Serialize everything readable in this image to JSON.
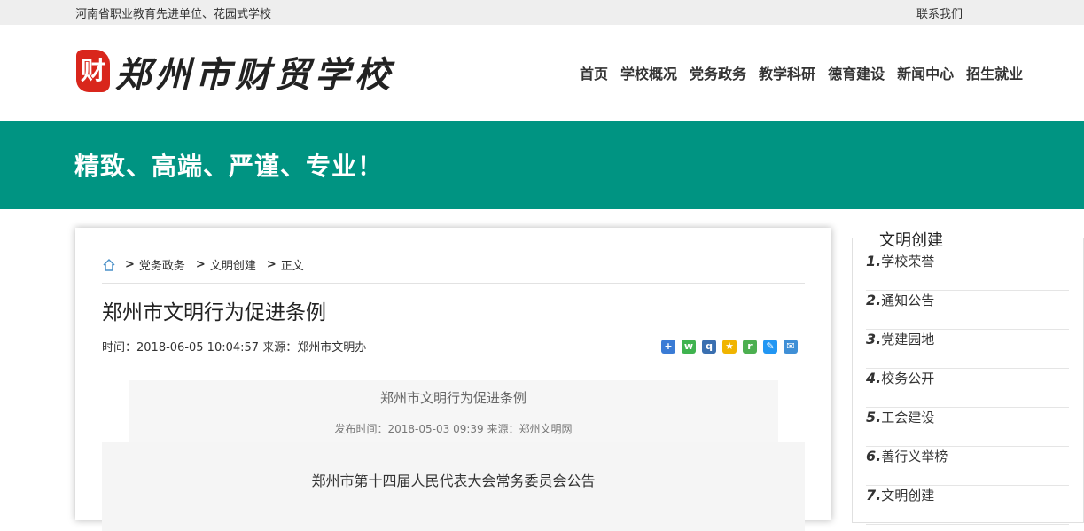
{
  "topbar": {
    "left_text": "河南省职业教育先进单位、花园式学校",
    "contact": "联系我们"
  },
  "logo": {
    "seal_char": "财",
    "name": "郑州市财贸学校"
  },
  "nav": {
    "items": [
      "首页",
      "学校概况",
      "党务政务",
      "教学科研",
      "德育建设",
      "新闻中心",
      "招生就业"
    ]
  },
  "banner": {
    "slogan": "精致、高端、严谨、专业！"
  },
  "breadcrumb": {
    "sep": ">",
    "items": [
      "党务政务",
      "文明创建",
      "正文"
    ]
  },
  "article": {
    "title": "郑州市文明行为促进条例",
    "meta": "时间：2018-06-05 10:04:57 来源：郑州市文明办",
    "inner_title": "郑州市文明行为促进条例",
    "inner_meta": "发布时间：2018-05-03 09:39   来源：郑州文明网",
    "notice_title": "郑州市第十四届人民代表大会常务委员会公告"
  },
  "share_icons": [
    "share-more-icon",
    "wechat-icon",
    "qq-icon",
    "qzone-icon",
    "renren-icon",
    "weibo-icon",
    "email-icon"
  ],
  "colors": {
    "banner": "#009482",
    "seal": "#d9261c"
  },
  "sidebar": {
    "title": "文明创建",
    "items": [
      {
        "num": "1.",
        "label": "学校荣誉"
      },
      {
        "num": "2.",
        "label": "通知公告"
      },
      {
        "num": "3.",
        "label": "党建园地"
      },
      {
        "num": "4.",
        "label": "校务公开"
      },
      {
        "num": "5.",
        "label": "工会建设"
      },
      {
        "num": "6.",
        "label": "善行义举榜"
      },
      {
        "num": "7.",
        "label": "文明创建"
      }
    ]
  }
}
